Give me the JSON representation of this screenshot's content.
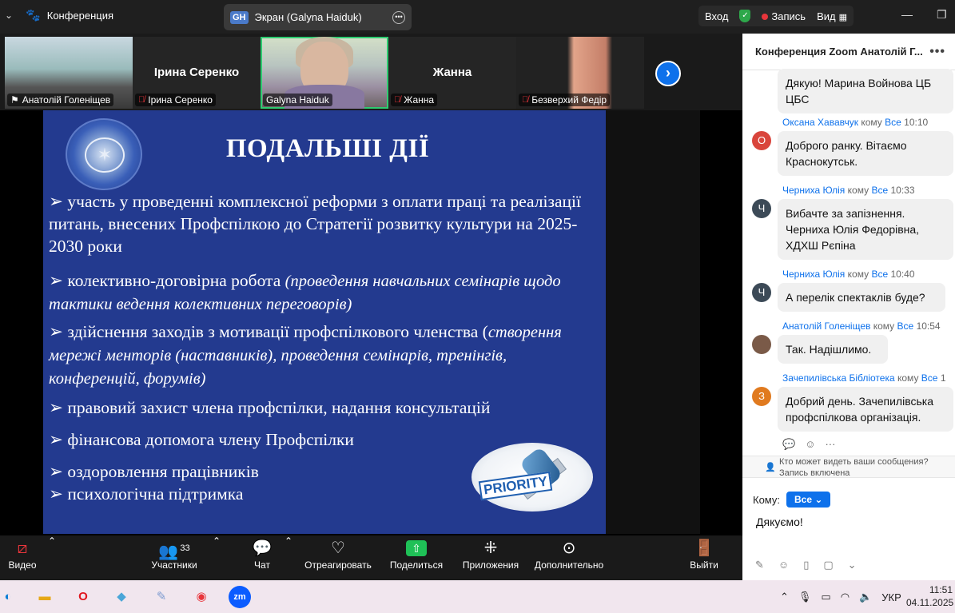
{
  "topbar": {
    "app_title": "Конференция",
    "screen_tab_initials": "GH",
    "screen_tab_label": "Экран (Galyna Haiduk)",
    "login_label": "Вход",
    "record_label": "Запись",
    "view_label": "Вид"
  },
  "participants_strip": [
    {
      "name": "Анатолій Голеніщев",
      "muted": false
    },
    {
      "name": "Ірина Серенко",
      "muted": true,
      "display_name": "Ірина Серенко"
    },
    {
      "name": "Galyna Haiduk",
      "muted": false
    },
    {
      "name": "Жанна",
      "muted": true,
      "display_name": "Жанна"
    },
    {
      "name": "Безверхий Федір",
      "muted": true
    }
  ],
  "slide": {
    "title": "ПОДАЛЬШІ ДІЇ",
    "bullets": [
      {
        "text": "участь у проведенні комплексної реформи з оплати праці та реалізації питань, внесених Профспілкою до Стратегії розвитку культури на 2025-2030 роки",
        "italic": ""
      },
      {
        "text": "колективно-договірна робота ",
        "italic": "(проведення навчальних семінарів щодо тактики ведення колективних переговорів)"
      },
      {
        "text": "здійснення заходів з мотивації профспілкового членства (",
        "italic": "створення мережі менторів  (наставників), проведення семінарів, тренінгів, конференцій, форумів)"
      },
      {
        "text": "правовий захист члена профспілки, надання консультацій",
        "italic": ""
      },
      {
        "text": "фінансова допомога члену Профспілки",
        "italic": ""
      },
      {
        "text": "оздоровлення працівників",
        "italic": ""
      },
      {
        "text": "психологічна підтримка",
        "italic": ""
      }
    ],
    "stamp_text": "PRIORITY"
  },
  "chat": {
    "header": "Конференция Zoom Анатолій Г...",
    "messages": [
      {
        "sender": "",
        "to": "",
        "time": "",
        "avatar": "",
        "avatar_color": "",
        "text": "Дякую!  Марина Войнова ЦБ ЦБС"
      },
      {
        "sender": "Оксана Хававчук",
        "to_word": "кому",
        "to": "Все",
        "time": "10:10",
        "avatar": "О",
        "avatar_color": "#d9453c",
        "text": "Доброго ранку. Вітаємо Краснокутськ."
      },
      {
        "sender": "Черниха Юлія",
        "to_word": "кому",
        "to": "Все",
        "time": "10:33",
        "avatar": "Ч",
        "avatar_color": "#3c4a57",
        "text": "Вибачте за запізнення. Черниха Юлія Федорівна, ХДХШ Рєпіна"
      },
      {
        "sender": "Черниха Юлія",
        "to_word": "кому",
        "to": "Все",
        "time": "10:40",
        "avatar": "Ч",
        "avatar_color": "#3c4a57",
        "text": "А перелік спектаклів буде?"
      },
      {
        "sender": "Анатолій Голеніщев",
        "to_word": "кому",
        "to": "Все",
        "time": "10:54",
        "avatar": "",
        "avatar_color": "#7a5a48",
        "text": "Так. Надішлимо."
      },
      {
        "sender": "Зачепилівська Бібліотека",
        "to_word": "кому",
        "to": "Все",
        "time": "1",
        "avatar": "З",
        "avatar_color": "#e07a1f",
        "text": "Добрий день. Зачепилівська профспілкова організація."
      }
    ],
    "visibility_note": "Кто может видеть ваши сообщения? Запись включена",
    "to_label": "Кому:",
    "to_value": "Все",
    "input_value": "Дякуємо!"
  },
  "toolbar": {
    "video": "Видео",
    "participants": "Участники",
    "participants_count": "33",
    "chat": "Чат",
    "react": "Отреагировать",
    "share": "Поделиться",
    "apps": "Приложения",
    "more": "Дополнительно",
    "leave": "Выйти"
  },
  "taskbar": {
    "lang": "УКР",
    "time": "11:51",
    "date": "04.11.2025"
  },
  "colors": {
    "slide_bg": "#233a8f",
    "accent_blue": "#0e71eb",
    "share_green": "#1fc157",
    "rec_red": "#e8353b"
  }
}
